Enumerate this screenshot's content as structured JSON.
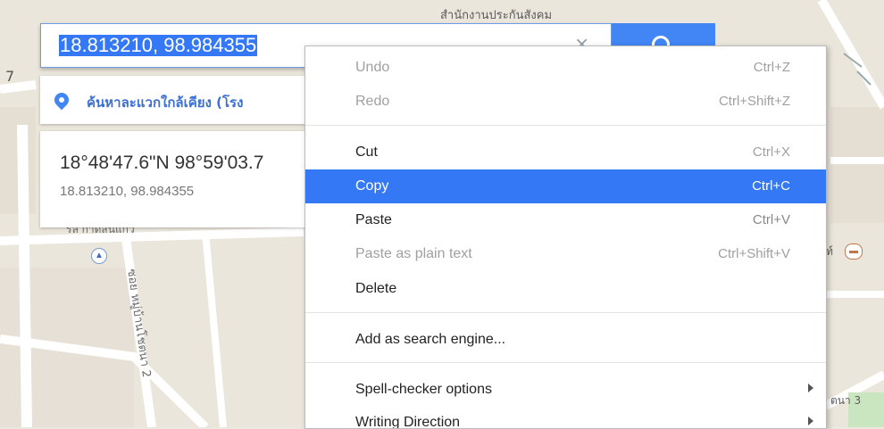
{
  "map": {
    "top_label": "สำนักงานประกันสังคม",
    "school_label": "รล กาดสนแกว",
    "soi_label": "ซอย หมู่บ้านโชตนา 2",
    "right_fragment": "ท์",
    "road_label": "ตนา 3",
    "left_arrow": "7"
  },
  "search": {
    "value": "18.813210, 98.984355",
    "clear_glyph": "×"
  },
  "nearby": {
    "label": "ค้นหาละแวกใกล้เคียง (โรง"
  },
  "coordinates": {
    "dms": "18°48'47.6\"N 98°59'03.7",
    "decimal": "18.813210, 98.984355"
  },
  "context_menu": {
    "undo": {
      "label": "Undo",
      "shortcut": "Ctrl+Z"
    },
    "redo": {
      "label": "Redo",
      "shortcut": "Ctrl+Shift+Z"
    },
    "cut": {
      "label": "Cut",
      "shortcut": "Ctrl+X"
    },
    "copy": {
      "label": "Copy",
      "shortcut": "Ctrl+C"
    },
    "paste": {
      "label": "Paste",
      "shortcut": "Ctrl+V"
    },
    "paste_plain": {
      "label": "Paste as plain text",
      "shortcut": "Ctrl+Shift+V"
    },
    "delete": {
      "label": "Delete"
    },
    "add_search_engine": {
      "label": "Add as search engine..."
    },
    "spell_checker": {
      "label": "Spell-checker options"
    },
    "writing_direction": {
      "label": "Writing Direction"
    }
  },
  "colors": {
    "accent": "#4285f4",
    "selection": "#3478f6",
    "link": "#3b6fd2"
  }
}
